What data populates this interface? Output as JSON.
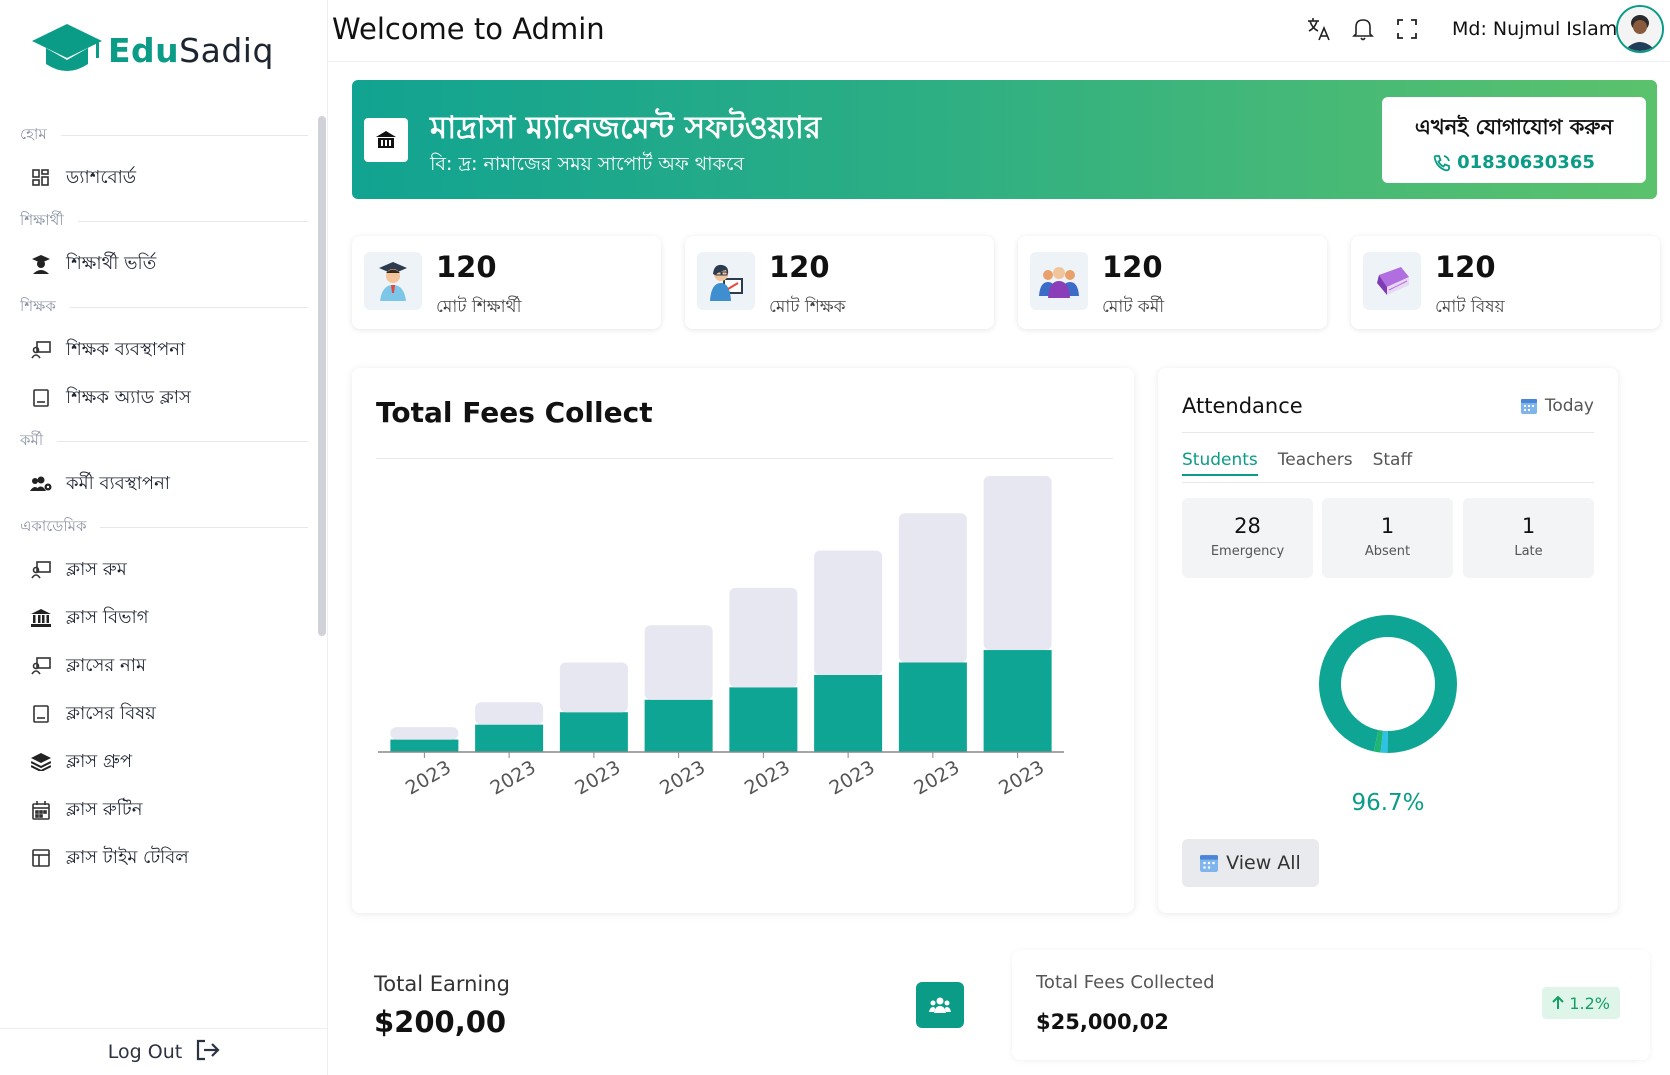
{
  "app": {
    "brand_edu": "Edu",
    "brand_sadiq": "Sadiq",
    "brand_color": "#0a9c86"
  },
  "header": {
    "welcome": "Welcome to Admin",
    "username": "Md: Nujmul Islam",
    "icons": [
      "translate-icon",
      "bell-icon",
      "fullscreen-icon"
    ]
  },
  "sidebar": {
    "sections": [
      {
        "label": "হোম",
        "items": [
          {
            "label": "ড্যাশবোর্ড",
            "icon": "dashboard-icon"
          }
        ]
      },
      {
        "label": "শিক্ষার্থী",
        "items": [
          {
            "label": "শিক্ষার্থী ভর্তি",
            "icon": "graduate-icon"
          }
        ]
      },
      {
        "label": "শিক্ষক",
        "items": [
          {
            "label": "শিক্ষক ব্যবস্থাপনা",
            "icon": "teacher-board-icon"
          },
          {
            "label": "শিক্ষক অ্যাড ক্লাস",
            "icon": "tablet-icon"
          }
        ]
      },
      {
        "label": "কর্মী",
        "items": [
          {
            "label": "কর্মী ব্যবস্থাপনা",
            "icon": "users-gear-icon"
          }
        ]
      },
      {
        "label": "একাডেমিক",
        "items": [
          {
            "label": "ক্লাস রুম",
            "icon": "teacher-board-icon"
          },
          {
            "label": "ক্লাস বিভাগ",
            "icon": "building-columns-icon"
          },
          {
            "label": "ক্লাসের নাম",
            "icon": "teacher-board-icon"
          },
          {
            "label": "ক্লাসের বিষয়",
            "icon": "tablet-icon"
          },
          {
            "label": "ক্লাস গ্রুপ",
            "icon": "layers-icon"
          },
          {
            "label": "ক্লাস রুটিন",
            "icon": "calendar-icon"
          },
          {
            "label": "ক্লাস টাইম টেবিল",
            "icon": "table-icon"
          }
        ]
      }
    ],
    "logout": "Log Out"
  },
  "banner": {
    "title": "মাদ্রাসা ম্যানেজমেন্ট সফটওয়্যার",
    "subtitle": "বি: দ্র: নামাজের সময় সাপোর্ট অফ থাকবে",
    "contact_title": "এখনই যোগাযোগ করুন",
    "contact_phone": "01830630365"
  },
  "stats": [
    {
      "value": "120",
      "label": "মোট শিক্ষার্থী",
      "icon": "student-icon"
    },
    {
      "value": "120",
      "label": "মোট শিক্ষক",
      "icon": "teacher-icon"
    },
    {
      "value": "120",
      "label": "মোট কর্মী",
      "icon": "staff-group-icon"
    },
    {
      "value": "120",
      "label": "মোট বিষয়",
      "icon": "book-icon"
    }
  ],
  "fees": {
    "title": "Total Fees Collect"
  },
  "chart_data": {
    "type": "bar",
    "stacked": true,
    "categories": [
      "2023",
      "2023",
      "2023",
      "2023",
      "2023",
      "2023",
      "2023",
      "2023"
    ],
    "series": [
      {
        "values": [
          10,
          22,
          32,
          42,
          52,
          62,
          72,
          82
        ],
        "color": "#0ea594"
      },
      {
        "values": [
          10,
          18,
          40,
          60,
          80,
          100,
          120,
          140
        ],
        "color": "#e6e7f1"
      }
    ],
    "ylim": [
      0,
      222
    ],
    "grid": false,
    "tick_rotation": -30
  },
  "attendance": {
    "title": "Attendance",
    "period": "Today",
    "tabs": [
      "Students",
      "Teachers",
      "Staff"
    ],
    "active_tab": 0,
    "stats": [
      {
        "value": "28",
        "label": "Emergency"
      },
      {
        "value": "1",
        "label": "Absent"
      },
      {
        "value": "1",
        "label": "Late"
      }
    ],
    "donut": [
      {
        "value": 96.7,
        "color": "#0ea594"
      },
      {
        "value": 1.6,
        "color": "#2ec3e6"
      },
      {
        "value": 1.7,
        "color": "#1fb573"
      }
    ],
    "percent": "96.7%",
    "view_all": "View All"
  },
  "earning": {
    "label": "Total Earning",
    "value": "$200,00",
    "icon": "users-icon"
  },
  "fees_collected": {
    "label": "Total Fees Collected",
    "value": "$25,000,02",
    "change": "1.2%",
    "change_color": "#13a065"
  }
}
